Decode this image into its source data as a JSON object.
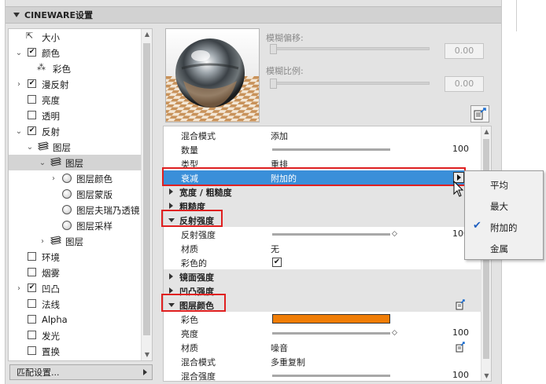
{
  "panel": {
    "title": "CINEWARE设置"
  },
  "tree": {
    "items": [
      {
        "label": "大小",
        "kind": "icon",
        "icon": "resize-icon",
        "indent": 0
      },
      {
        "label": "颜色",
        "kind": "check",
        "checked": true,
        "expander": "expanded",
        "indent": 0
      },
      {
        "label": "彩色",
        "kind": "icon",
        "icon": "color-dots-icon",
        "indent": 1
      },
      {
        "label": "漫反射",
        "kind": "check",
        "checked": true,
        "expander": "collapsed",
        "indent": 0
      },
      {
        "label": "亮度",
        "kind": "check",
        "checked": false,
        "indent": 0
      },
      {
        "label": "透明",
        "kind": "check",
        "checked": false,
        "indent": 0
      },
      {
        "label": "反射",
        "kind": "check",
        "checked": true,
        "expander": "expanded",
        "indent": 0
      },
      {
        "label": "图层",
        "kind": "icon",
        "icon": "layers-icon",
        "expander": "expanded",
        "indent": 1
      },
      {
        "label": "图层",
        "kind": "icon",
        "icon": "layers-icon",
        "expander": "expanded",
        "indent": 2,
        "selected": true
      },
      {
        "label": "图层颜色",
        "kind": "radio",
        "expander": "collapsed",
        "indent": 3
      },
      {
        "label": "图层蒙版",
        "kind": "radio",
        "indent": 3
      },
      {
        "label": "图层夫瑞乃透镜",
        "kind": "radio",
        "indent": 3
      },
      {
        "label": "图层采样",
        "kind": "radio",
        "indent": 3
      },
      {
        "label": "图层",
        "kind": "icon",
        "icon": "layers-icon",
        "expander": "collapsed",
        "indent": 2
      },
      {
        "label": "环境",
        "kind": "check",
        "checked": false,
        "indent": 0
      },
      {
        "label": "烟雾",
        "kind": "check",
        "checked": false,
        "indent": 0
      },
      {
        "label": "凹凸",
        "kind": "check",
        "checked": true,
        "expander": "collapsed",
        "indent": 0
      },
      {
        "label": "法线",
        "kind": "check",
        "checked": false,
        "indent": 0
      },
      {
        "label": "Alpha",
        "kind": "check",
        "checked": false,
        "indent": 0
      },
      {
        "label": "发光",
        "kind": "check",
        "checked": false,
        "indent": 0
      },
      {
        "label": "置换",
        "kind": "check",
        "checked": false,
        "indent": 0
      }
    ]
  },
  "match_button": {
    "label": "匹配设置..."
  },
  "blur": {
    "offset_label": "模糊偏移:",
    "offset_value": "0.00",
    "scale_label": "模糊比例:",
    "scale_value": "0.00"
  },
  "properties": {
    "rows": [
      {
        "type": "row",
        "label": "混合模式",
        "value": "添加"
      },
      {
        "type": "slider",
        "label": "数量",
        "value": 100,
        "number": "100"
      },
      {
        "type": "row",
        "label": "类型",
        "value": "重排"
      },
      {
        "type": "row",
        "label": "衰减",
        "value": "附加的",
        "selected": true,
        "dropdown": true
      },
      {
        "type": "header",
        "label": "宽度 / 粗糙度",
        "open": false
      },
      {
        "type": "header",
        "label": "粗糙度",
        "open": false
      },
      {
        "type": "header",
        "label": "反射强度",
        "open": true
      },
      {
        "type": "slider",
        "label": "反射强度",
        "value": 100,
        "number": "100",
        "arrow": true
      },
      {
        "type": "row",
        "label": "材质",
        "value": "无"
      },
      {
        "type": "check",
        "label": "彩色的",
        "checked": true
      },
      {
        "type": "header",
        "label": "镜面强度",
        "open": false
      },
      {
        "type": "header",
        "label": "凹凸强度",
        "open": false
      },
      {
        "type": "header",
        "label": "图层颜色",
        "open": true,
        "icon": true
      },
      {
        "type": "color",
        "label": "彩色",
        "color": "#f07d06"
      },
      {
        "type": "slider",
        "label": "亮度",
        "value": 100,
        "number": "100",
        "arrow": true
      },
      {
        "type": "row",
        "label": "材质",
        "value": "噪音",
        "icon": true
      },
      {
        "type": "row",
        "label": "混合模式",
        "value": "多重复制"
      },
      {
        "type": "slider",
        "label": "混合强度",
        "value": 100,
        "number": "100"
      }
    ]
  },
  "menu": {
    "items": [
      {
        "label": "平均",
        "checked": false
      },
      {
        "label": "最大",
        "checked": false
      },
      {
        "label": "附加的",
        "checked": true
      },
      {
        "label": "金属",
        "checked": false
      }
    ]
  }
}
